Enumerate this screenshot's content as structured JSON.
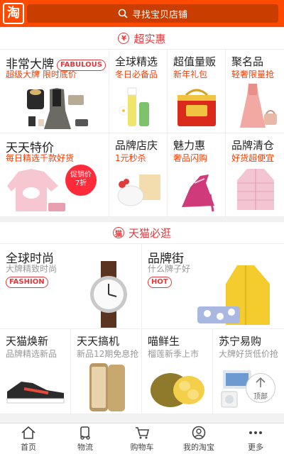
{
  "header": {
    "logo_text": "淘",
    "search_placeholder": "寻找宝贝店铺"
  },
  "section1": {
    "title": "超实惠"
  },
  "section2": {
    "title": "天猫必逛"
  },
  "row1": [
    {
      "title": "非常大牌",
      "badge": "FABULOUS",
      "subtitle": "超级大牌  限时底价"
    },
    {
      "title": "全球精选",
      "subtitle": "冬日必备品"
    },
    {
      "title": "超值量贩",
      "subtitle": "新年礼包"
    },
    {
      "title": "聚名品",
      "subtitle": "轻奢限量抢"
    }
  ],
  "row2": [
    {
      "title": "天天特价",
      "subtitle": "每日精选千款好货",
      "promo_line1": "促销价",
      "promo_line2": "7折"
    },
    {
      "title": "品牌店庆",
      "subtitle": "1元秒杀"
    },
    {
      "title": "魅力惠",
      "subtitle": "奢品闪购"
    },
    {
      "title": "品牌清仓",
      "subtitle": "好货超便宜"
    }
  ],
  "row3": [
    {
      "title": "全球时尚",
      "subtitle": "大牌精致时尚",
      "badge": "FASHION"
    },
    {
      "title": "品牌街",
      "subtitle": "什么牌子好",
      "badge": "HOT"
    }
  ],
  "row4": [
    {
      "title": "天猫焕新",
      "subtitle": "品牌精选新品"
    },
    {
      "title": "天天搞机",
      "subtitle": "新品12期免息抢"
    },
    {
      "title": "喵鲜生",
      "subtitle": "榴莲新季上市"
    },
    {
      "title": "苏宁易购",
      "subtitle": "大牌好货低价抢"
    }
  ],
  "back_to_top": "顶部",
  "nav": [
    {
      "label": "首页",
      "icon": "home-icon"
    },
    {
      "label": "物流",
      "icon": "truck-icon"
    },
    {
      "label": "购物车",
      "icon": "cart-icon"
    },
    {
      "label": "我的淘宝",
      "icon": "user-icon"
    },
    {
      "label": "更多",
      "icon": "more-icon"
    }
  ],
  "colors": {
    "brand": "#ff4a00",
    "accent": "#e4393c",
    "subtitle": "#ff3a00"
  }
}
